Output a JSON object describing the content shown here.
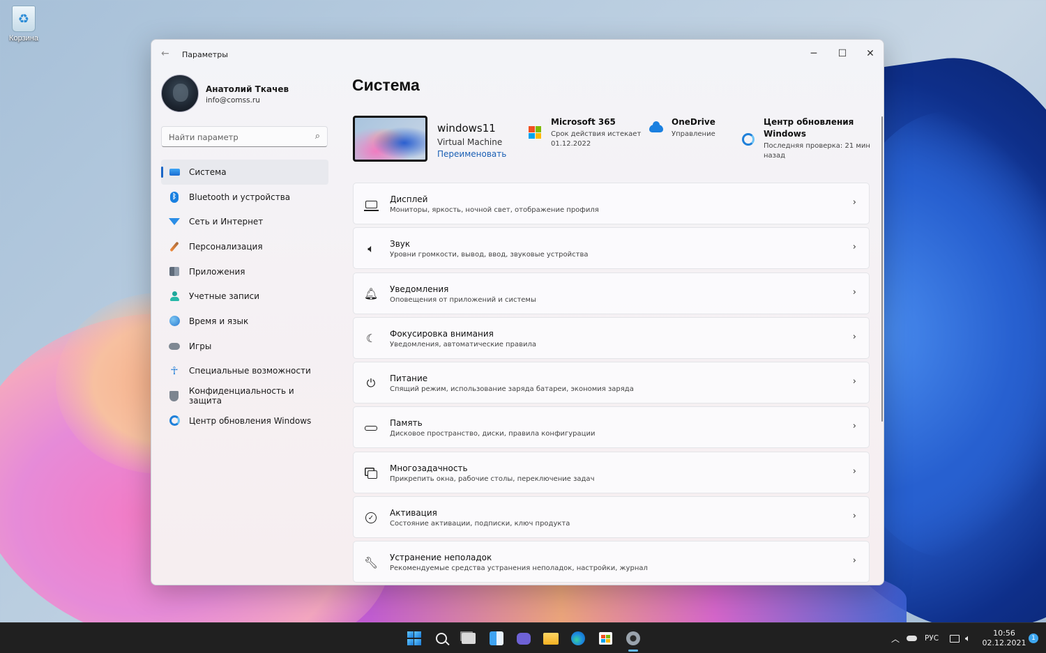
{
  "desktop": {
    "icons": [
      {
        "label": "Корзина",
        "icon": "recycle-bin-icon"
      }
    ]
  },
  "window": {
    "title": "Параметры",
    "back_icon": "back-arrow-icon"
  },
  "profile": {
    "name": "Анатолий Ткачев",
    "email": "info@comss.ru"
  },
  "search": {
    "placeholder": "Найти параметр"
  },
  "nav": {
    "items": [
      {
        "label": "Система",
        "icon": "monitor-icon",
        "active": true
      },
      {
        "label": "Bluetooth и устройства",
        "icon": "bluetooth-icon"
      },
      {
        "label": "Сеть и Интернет",
        "icon": "wifi-icon"
      },
      {
        "label": "Персонализация",
        "icon": "brush-icon"
      },
      {
        "label": "Приложения",
        "icon": "apps-icon"
      },
      {
        "label": "Учетные записи",
        "icon": "user-icon"
      },
      {
        "label": "Время и язык",
        "icon": "globe-icon"
      },
      {
        "label": "Игры",
        "icon": "gamepad-icon"
      },
      {
        "label": "Специальные возможности",
        "icon": "accessibility-icon"
      },
      {
        "label": "Конфиденциальность и защита",
        "icon": "shield-icon"
      },
      {
        "label": "Центр обновления Windows",
        "icon": "update-icon"
      }
    ]
  },
  "main": {
    "title": "Система",
    "device": {
      "name": "windows11",
      "type": "Virtual Machine",
      "rename_label": "Переименовать"
    },
    "info": [
      {
        "title": "Microsoft 365",
        "sub": "Срок действия истекает 01.12.2022",
        "icon": "microsoft-logo-icon"
      },
      {
        "title": "OneDrive",
        "sub": "Управление",
        "icon": "onedrive-cloud-icon"
      },
      {
        "title": "Центр обновления Windows",
        "sub": "Последняя проверка: 21 мин назад",
        "icon": "windows-update-icon"
      }
    ],
    "cards": [
      {
        "title": "Дисплей",
        "desc": "Мониторы, яркость, ночной свет, отображение профиля",
        "icon": "display-icon"
      },
      {
        "title": "Звук",
        "desc": "Уровни громкости, вывод, ввод, звуковые устройства",
        "icon": "speaker-icon"
      },
      {
        "title": "Уведомления",
        "desc": "Оповещения от приложений и системы",
        "icon": "bell-icon"
      },
      {
        "title": "Фокусировка внимания",
        "desc": "Уведомления, автоматические правила",
        "icon": "moon-icon"
      },
      {
        "title": "Питание",
        "desc": "Спящий режим, использование заряда батареи, экономия заряда",
        "icon": "power-icon"
      },
      {
        "title": "Память",
        "desc": "Дисковое пространство, диски, правила конфигурации",
        "icon": "storage-icon"
      },
      {
        "title": "Многозадачность",
        "desc": "Прикрепить окна, рабочие столы, переключение задач",
        "icon": "multitasking-icon"
      },
      {
        "title": "Активация",
        "desc": "Состояние активации, подписки, ключ продукта",
        "icon": "check-circle-icon"
      },
      {
        "title": "Устранение неполадок",
        "desc": "Рекомендуемые средства устранения неполадок, настройки, журнал",
        "icon": "wrench-icon"
      }
    ]
  },
  "taskbar": {
    "apps": [
      "start-icon",
      "search-icon",
      "task-view-icon",
      "widgets-icon",
      "chat-icon",
      "file-explorer-icon",
      "edge-icon",
      "store-icon",
      "settings-icon"
    ],
    "tray": {
      "lang": "РУС",
      "time": "10:56",
      "date": "02.12.2021",
      "notifications": "1"
    }
  }
}
